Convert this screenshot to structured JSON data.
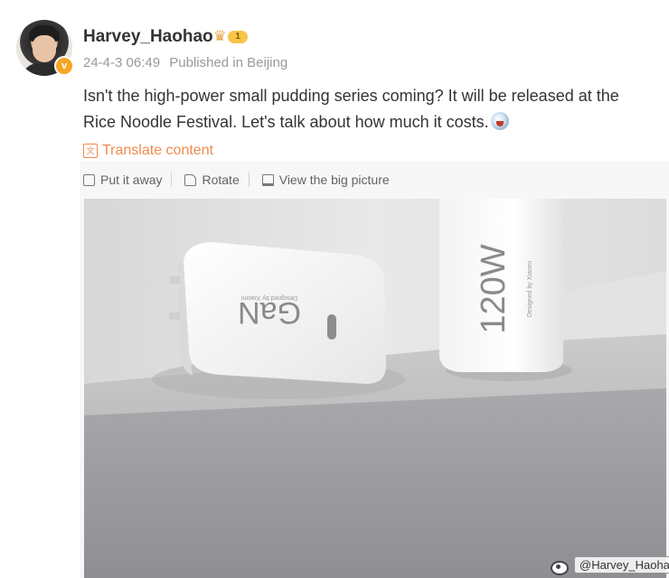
{
  "post": {
    "author": {
      "username": "Harvey_Haohao",
      "verified_icon": "verified-v-icon",
      "badge_icon": "crown-icon",
      "badge_level": "1"
    },
    "timestamp": "24-4-3 06:49",
    "location": "Published in Beijing",
    "text": "Isn't the high-power small pudding series coming? It will be released at the Rice Noodle Festival. Let's talk about how much it costs.",
    "translate_label": "Translate content"
  },
  "media_toolbar": {
    "put_away": "Put it away",
    "rotate": "Rotate",
    "view_big": "View the big picture"
  },
  "photo": {
    "product_left_text": "GaN",
    "product_left_subtext": "Designed by Xiaomi",
    "product_right_text": "120W",
    "product_right_subtext": "Designed by Xiaomi",
    "watermark": "@Harvey_Haohao"
  },
  "colors": {
    "accent_orange": "#f08a4b",
    "badge_gold": "#f7c548",
    "verified_orange": "#f5a623"
  }
}
